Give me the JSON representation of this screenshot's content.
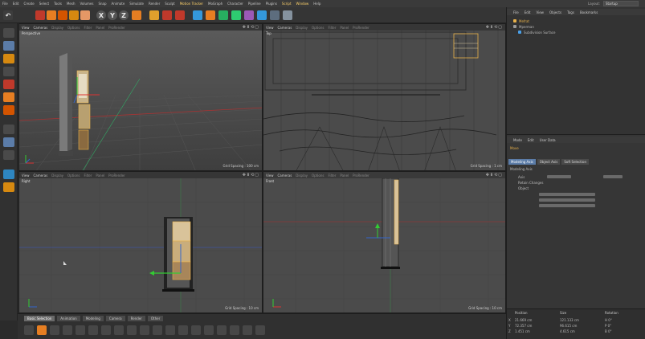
{
  "menubar": {
    "items": [
      "File",
      "Edit",
      "Create",
      "Select",
      "Tools",
      "Mesh",
      "Volumes",
      "Snap",
      "Animate",
      "Simulate",
      "Render",
      "Sculpt",
      "Motion Tracker",
      "MoGraph",
      "Character",
      "Pipeline",
      "Plugins",
      "Script",
      "Window",
      "Help"
    ],
    "layout_label": "Layout:",
    "layout_value": "Startup"
  },
  "toolbar": {
    "axis_x": "X",
    "axis_y": "Y",
    "axis_z": "Z"
  },
  "viewports": {
    "perspective": {
      "menu": [
        "View",
        "Cameras",
        "Display",
        "Options",
        "Filter",
        "Panel",
        "ProRender"
      ],
      "name": "Perspective",
      "grid": "Grid Spacing : 100 cm"
    },
    "top": {
      "menu": [
        "View",
        "Cameras",
        "Display",
        "Options",
        "Filter",
        "Panel",
        "ProRender"
      ],
      "name": "Top",
      "grid": "Grid Spacing : 1 cm"
    },
    "right": {
      "menu": [
        "View",
        "Cameras",
        "Display",
        "Options",
        "Filter",
        "Panel",
        "ProRender"
      ],
      "name": "Right",
      "grid": "Grid Spacing : 10 cm"
    },
    "front": {
      "menu": [
        "View",
        "Cameras",
        "Display",
        "Options",
        "Filter",
        "Panel",
        "ProRender"
      ],
      "name": "Front",
      "grid": "Grid Spacing : 10 cm"
    }
  },
  "objects": {
    "menu": [
      "File",
      "Edit",
      "View",
      "Objects",
      "Tags",
      "Bookmarks"
    ],
    "rows": [
      {
        "name": "Mefrat",
        "color": "#e8b14a"
      },
      {
        "name": "Mperman",
        "color": "#9a9a9a"
      },
      {
        "name": "Subdivision Surface",
        "color": "#4aa0e8"
      }
    ]
  },
  "attributes": {
    "menu": [
      "Mode",
      "Edit",
      "User Data"
    ],
    "title": "Move",
    "tabs": [
      "Modeling Axis",
      "Object Axis",
      "Soft Selection"
    ],
    "section": "Modeling Axis",
    "lines": [
      "Axis",
      "Retain Changes",
      "Object"
    ]
  },
  "coordinates": {
    "headers": [
      "Position",
      "Size",
      "Rotation"
    ],
    "rows": [
      {
        "axis": "X",
        "pos": "21.669 cm",
        "size": "121.133 cm",
        "rot": "H 0°"
      },
      {
        "axis": "Y",
        "pos": "72.357 cm",
        "size": "96.615 cm",
        "rot": "P 0°"
      },
      {
        "axis": "Z",
        "pos": "1.451 cm",
        "size": "4.615 cm",
        "rot": "B 0°"
      }
    ]
  },
  "timeline": {
    "tabs": [
      "Basic Selection",
      "Animation",
      "Modeling",
      "Camera",
      "Render",
      "Other"
    ]
  },
  "colors": {
    "accent": "#5b7ca8",
    "highlight": "#ffd36b",
    "viewport_bg": "#4a4a4a",
    "object_orange": "#e8b14a"
  }
}
